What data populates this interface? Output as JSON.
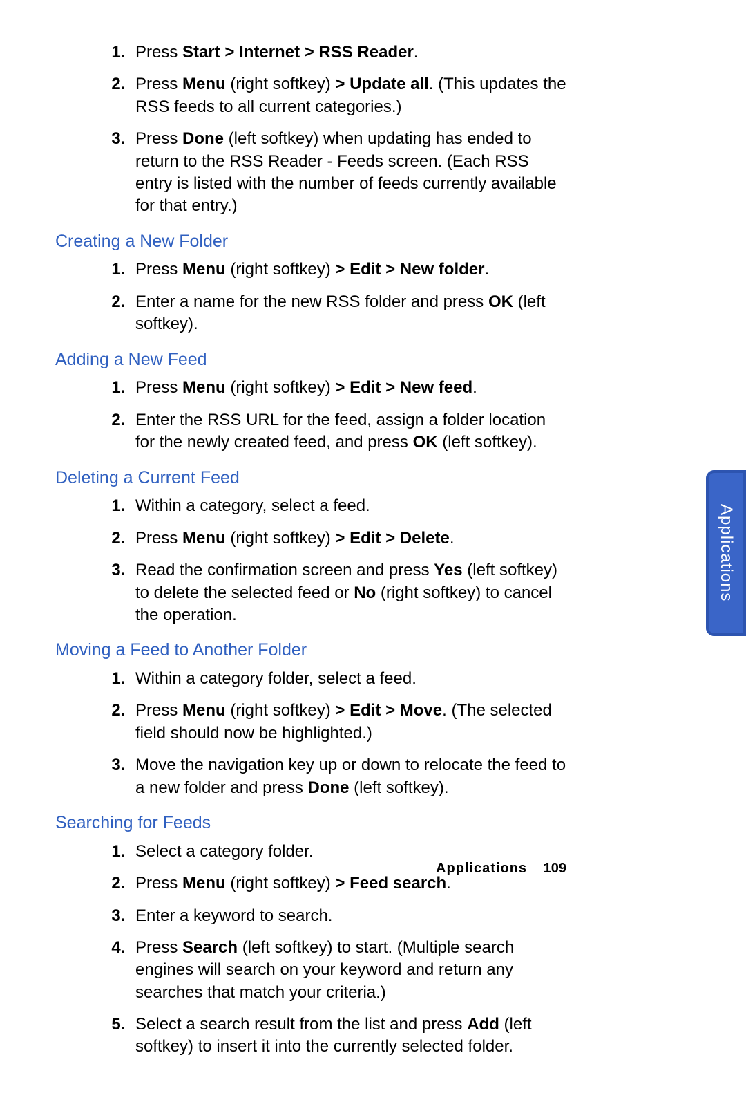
{
  "sideTab": "Applications",
  "footer": {
    "section": "Applications",
    "page": "109"
  },
  "sections": [
    {
      "heading": null,
      "items": [
        [
          {
            "t": "Press "
          },
          {
            "t": "Start > Internet > RSS Reader",
            "b": true
          },
          {
            "t": "."
          }
        ],
        [
          {
            "t": "Press "
          },
          {
            "t": "Menu",
            "b": true
          },
          {
            "t": " (right softkey) "
          },
          {
            "t": "> Update all",
            "b": true
          },
          {
            "t": ". (This updates the RSS feeds to all current categories.)"
          }
        ],
        [
          {
            "t": "Press "
          },
          {
            "t": "Done",
            "b": true
          },
          {
            "t": " (left softkey) when updating has ended to return to the RSS Reader - Feeds screen. (Each RSS entry is listed with the number of feeds currently available for that entry.)"
          }
        ]
      ]
    },
    {
      "heading": "Creating a New Folder",
      "items": [
        [
          {
            "t": "Press "
          },
          {
            "t": "Menu",
            "b": true
          },
          {
            "t": " (right softkey) "
          },
          {
            "t": "> Edit > New folder",
            "b": true
          },
          {
            "t": "."
          }
        ],
        [
          {
            "t": "Enter a name for the new RSS folder and press "
          },
          {
            "t": "OK",
            "b": true
          },
          {
            "t": " (left softkey)."
          }
        ]
      ]
    },
    {
      "heading": "Adding a New Feed",
      "items": [
        [
          {
            "t": "Press "
          },
          {
            "t": "Menu",
            "b": true
          },
          {
            "t": " (right softkey) "
          },
          {
            "t": "> Edit > New feed",
            "b": true
          },
          {
            "t": "."
          }
        ],
        [
          {
            "t": "Enter the RSS URL for the feed, assign a folder location for the newly created feed, and press "
          },
          {
            "t": "OK",
            "b": true
          },
          {
            "t": " (left softkey)."
          }
        ]
      ]
    },
    {
      "heading": "Deleting a Current Feed",
      "items": [
        [
          {
            "t": "Within a category, select a feed."
          }
        ],
        [
          {
            "t": "Press "
          },
          {
            "t": "Menu",
            "b": true
          },
          {
            "t": " (right softkey) "
          },
          {
            "t": "> Edit > Delete",
            "b": true
          },
          {
            "t": "."
          }
        ],
        [
          {
            "t": "Read the confirmation screen and press "
          },
          {
            "t": "Yes",
            "b": true
          },
          {
            "t": " (left softkey) to delete the selected feed or "
          },
          {
            "t": "No",
            "b": true
          },
          {
            "t": " (right softkey) to cancel the operation."
          }
        ]
      ]
    },
    {
      "heading": "Moving a Feed to Another Folder",
      "items": [
        [
          {
            "t": "Within a category folder, select a feed."
          }
        ],
        [
          {
            "t": "Press "
          },
          {
            "t": "Menu",
            "b": true
          },
          {
            "t": " (right softkey) "
          },
          {
            "t": "> Edit > Move",
            "b": true
          },
          {
            "t": ". (The selected field should now be highlighted.)"
          }
        ],
        [
          {
            "t": "Move the navigation key up or down to relocate the feed to a new folder and press "
          },
          {
            "t": "Done",
            "b": true
          },
          {
            "t": " (left softkey)."
          }
        ]
      ]
    },
    {
      "heading": "Searching for Feeds",
      "items": [
        [
          {
            "t": "Select a category folder."
          }
        ],
        [
          {
            "t": "Press "
          },
          {
            "t": "Menu",
            "b": true
          },
          {
            "t": " (right softkey) "
          },
          {
            "t": "> Feed search",
            "b": true
          },
          {
            "t": "."
          }
        ],
        [
          {
            "t": "Enter a keyword to search."
          }
        ],
        [
          {
            "t": "Press "
          },
          {
            "t": "Search",
            "b": true
          },
          {
            "t": " (left softkey) to start. (Multiple search engines will search on your keyword and return any searches that match your criteria.)"
          }
        ],
        [
          {
            "t": "Select a search result from the list and press "
          },
          {
            "t": "Add",
            "b": true
          },
          {
            "t": " (left softkey) to insert it into the currently selected folder."
          }
        ]
      ]
    }
  ]
}
